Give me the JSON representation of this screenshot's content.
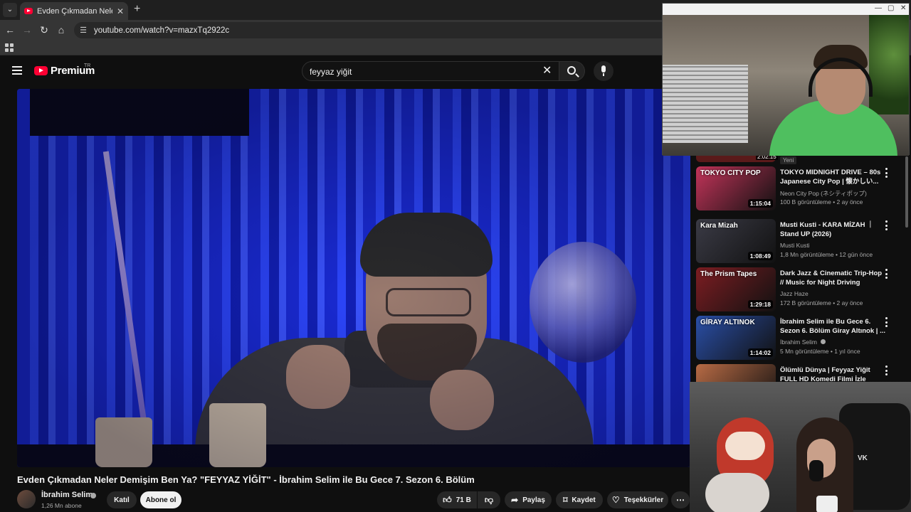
{
  "browser": {
    "tab_title": "Evden Çıkmadan Neler Demişim Ben Ya? \"FEYYAZ YİĞİT\"",
    "url": "youtube.com/watch?v=mazxTq2922c"
  },
  "youtube": {
    "logo_text": "Premium",
    "country_code": "TR",
    "search_value": "feyyaz yiğit",
    "video_title": "Evden Çıkmadan Neler Demişim Ben Ya? \"FEYYAZ YİĞİT\" - İbrahim Selim ile Bu Gece 7. Sezon 6. Bölüm",
    "channel_name": "İbrahim Selim",
    "subscribers": "1,26 Mn abone",
    "join_label": "Katıl",
    "subscribe_label": "Abone ol",
    "likes": "71 B",
    "share_label": "Paylaş",
    "save_label": "Kaydet",
    "thanks_label": "Teşekkürler"
  },
  "sidebar": {
    "partial_duration": "2:02:15",
    "new_badge": "Yeni",
    "items": [
      {
        "title": "TOKYO MIDNIGHT DRIVE – 80s Japanese City Pop | 懐かしい...",
        "channel": "Neon City Pop (ネシティポップ)",
        "meta": "100 B görüntüleme • 2 ay önce",
        "duration": "1:15:04",
        "thumb_label": "TOKYO CITY POP",
        "thumb_color": "#c4345a"
      },
      {
        "title": "Musti Kusti - KARA MİZAH ｜ Stand UP (2026)",
        "channel": "Musti Kusti",
        "meta": "1,8 Mn görüntüleme • 12 gün önce",
        "duration": "1:08:49",
        "thumb_label": "Kara Mizah",
        "thumb_color": "#3b3b46"
      },
      {
        "title": "Dark Jazz & Cinematic Trip-Hop // Music for Night Driving",
        "channel": "Jazz Haze",
        "meta": "172 B görüntüleme • 2 ay önce",
        "duration": "1:29:18",
        "thumb_label": "The Prism Tapes",
        "thumb_color": "#7d1d22"
      },
      {
        "title": "İbrahim Selim ile Bu Gece 6. Sezon 6. Bölüm Giray Altınok | ...",
        "channel": "İbrahim Selim",
        "meta": "5 Mn görüntüleme • 1 yıl önce",
        "duration": "1:14:02",
        "thumb_label": "GİRAY ALTINOK",
        "thumb_color": "#2a4fa8"
      },
      {
        "title": "Ölümlü Dünya | Feyyaz Yiğit FULL HD Komedi Filmi İzle",
        "channel": "",
        "meta": "",
        "duration": "",
        "thumb_label": "",
        "thumb_color": "#b86b45"
      }
    ]
  },
  "webcam": {
    "chair_logo": "VK"
  },
  "icons": {
    "tab_menu": "chevron-down-icon",
    "back": "arrow-left-icon",
    "forward": "arrow-right-icon",
    "reload": "reload-icon",
    "home": "home-icon",
    "site_info": "tune-icon",
    "apps": "apps-grid-icon",
    "menu": "hamburger-icon",
    "search": "search-icon",
    "clear": "close-icon",
    "mic": "mic-icon",
    "like": "thumbs-up-icon",
    "dislike": "thumbs-down-icon",
    "share": "share-arrow-icon",
    "save": "bookmark-icon",
    "thanks": "heart-dollar-icon",
    "more": "more-horizontal-icon"
  },
  "colors": {
    "brand_red": "#ff0033",
    "background": "#0f0f0f",
    "accent_pill": "#272727"
  }
}
